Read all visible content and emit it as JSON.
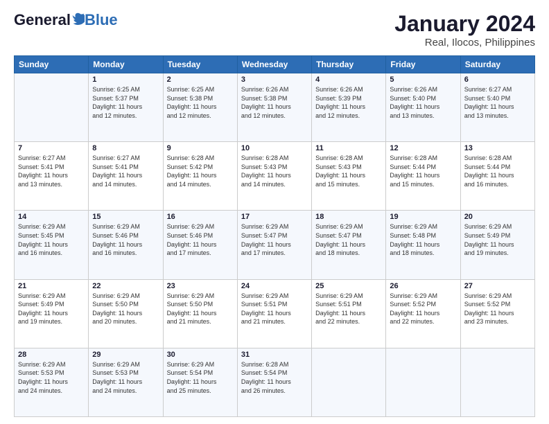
{
  "header": {
    "logo_general": "General",
    "logo_blue": "Blue",
    "title": "January 2024",
    "subtitle": "Real, Ilocos, Philippines"
  },
  "calendar": {
    "days_of_week": [
      "Sunday",
      "Monday",
      "Tuesday",
      "Wednesday",
      "Thursday",
      "Friday",
      "Saturday"
    ],
    "weeks": [
      [
        {
          "day": "",
          "info": ""
        },
        {
          "day": "1",
          "info": "Sunrise: 6:25 AM\nSunset: 5:37 PM\nDaylight: 11 hours\nand 12 minutes."
        },
        {
          "day": "2",
          "info": "Sunrise: 6:25 AM\nSunset: 5:38 PM\nDaylight: 11 hours\nand 12 minutes."
        },
        {
          "day": "3",
          "info": "Sunrise: 6:26 AM\nSunset: 5:38 PM\nDaylight: 11 hours\nand 12 minutes."
        },
        {
          "day": "4",
          "info": "Sunrise: 6:26 AM\nSunset: 5:39 PM\nDaylight: 11 hours\nand 12 minutes."
        },
        {
          "day": "5",
          "info": "Sunrise: 6:26 AM\nSunset: 5:40 PM\nDaylight: 11 hours\nand 13 minutes."
        },
        {
          "day": "6",
          "info": "Sunrise: 6:27 AM\nSunset: 5:40 PM\nDaylight: 11 hours\nand 13 minutes."
        }
      ],
      [
        {
          "day": "7",
          "info": "Sunrise: 6:27 AM\nSunset: 5:41 PM\nDaylight: 11 hours\nand 13 minutes."
        },
        {
          "day": "8",
          "info": "Sunrise: 6:27 AM\nSunset: 5:41 PM\nDaylight: 11 hours\nand 14 minutes."
        },
        {
          "day": "9",
          "info": "Sunrise: 6:28 AM\nSunset: 5:42 PM\nDaylight: 11 hours\nand 14 minutes."
        },
        {
          "day": "10",
          "info": "Sunrise: 6:28 AM\nSunset: 5:43 PM\nDaylight: 11 hours\nand 14 minutes."
        },
        {
          "day": "11",
          "info": "Sunrise: 6:28 AM\nSunset: 5:43 PM\nDaylight: 11 hours\nand 15 minutes."
        },
        {
          "day": "12",
          "info": "Sunrise: 6:28 AM\nSunset: 5:44 PM\nDaylight: 11 hours\nand 15 minutes."
        },
        {
          "day": "13",
          "info": "Sunrise: 6:28 AM\nSunset: 5:44 PM\nDaylight: 11 hours\nand 16 minutes."
        }
      ],
      [
        {
          "day": "14",
          "info": "Sunrise: 6:29 AM\nSunset: 5:45 PM\nDaylight: 11 hours\nand 16 minutes."
        },
        {
          "day": "15",
          "info": "Sunrise: 6:29 AM\nSunset: 5:46 PM\nDaylight: 11 hours\nand 16 minutes."
        },
        {
          "day": "16",
          "info": "Sunrise: 6:29 AM\nSunset: 5:46 PM\nDaylight: 11 hours\nand 17 minutes."
        },
        {
          "day": "17",
          "info": "Sunrise: 6:29 AM\nSunset: 5:47 PM\nDaylight: 11 hours\nand 17 minutes."
        },
        {
          "day": "18",
          "info": "Sunrise: 6:29 AM\nSunset: 5:47 PM\nDaylight: 11 hours\nand 18 minutes."
        },
        {
          "day": "19",
          "info": "Sunrise: 6:29 AM\nSunset: 5:48 PM\nDaylight: 11 hours\nand 18 minutes."
        },
        {
          "day": "20",
          "info": "Sunrise: 6:29 AM\nSunset: 5:49 PM\nDaylight: 11 hours\nand 19 minutes."
        }
      ],
      [
        {
          "day": "21",
          "info": "Sunrise: 6:29 AM\nSunset: 5:49 PM\nDaylight: 11 hours\nand 19 minutes."
        },
        {
          "day": "22",
          "info": "Sunrise: 6:29 AM\nSunset: 5:50 PM\nDaylight: 11 hours\nand 20 minutes."
        },
        {
          "day": "23",
          "info": "Sunrise: 6:29 AM\nSunset: 5:50 PM\nDaylight: 11 hours\nand 21 minutes."
        },
        {
          "day": "24",
          "info": "Sunrise: 6:29 AM\nSunset: 5:51 PM\nDaylight: 11 hours\nand 21 minutes."
        },
        {
          "day": "25",
          "info": "Sunrise: 6:29 AM\nSunset: 5:51 PM\nDaylight: 11 hours\nand 22 minutes."
        },
        {
          "day": "26",
          "info": "Sunrise: 6:29 AM\nSunset: 5:52 PM\nDaylight: 11 hours\nand 22 minutes."
        },
        {
          "day": "27",
          "info": "Sunrise: 6:29 AM\nSunset: 5:52 PM\nDaylight: 11 hours\nand 23 minutes."
        }
      ],
      [
        {
          "day": "28",
          "info": "Sunrise: 6:29 AM\nSunset: 5:53 PM\nDaylight: 11 hours\nand 24 minutes."
        },
        {
          "day": "29",
          "info": "Sunrise: 6:29 AM\nSunset: 5:53 PM\nDaylight: 11 hours\nand 24 minutes."
        },
        {
          "day": "30",
          "info": "Sunrise: 6:29 AM\nSunset: 5:54 PM\nDaylight: 11 hours\nand 25 minutes."
        },
        {
          "day": "31",
          "info": "Sunrise: 6:28 AM\nSunset: 5:54 PM\nDaylight: 11 hours\nand 26 minutes."
        },
        {
          "day": "",
          "info": ""
        },
        {
          "day": "",
          "info": ""
        },
        {
          "day": "",
          "info": ""
        }
      ]
    ]
  }
}
